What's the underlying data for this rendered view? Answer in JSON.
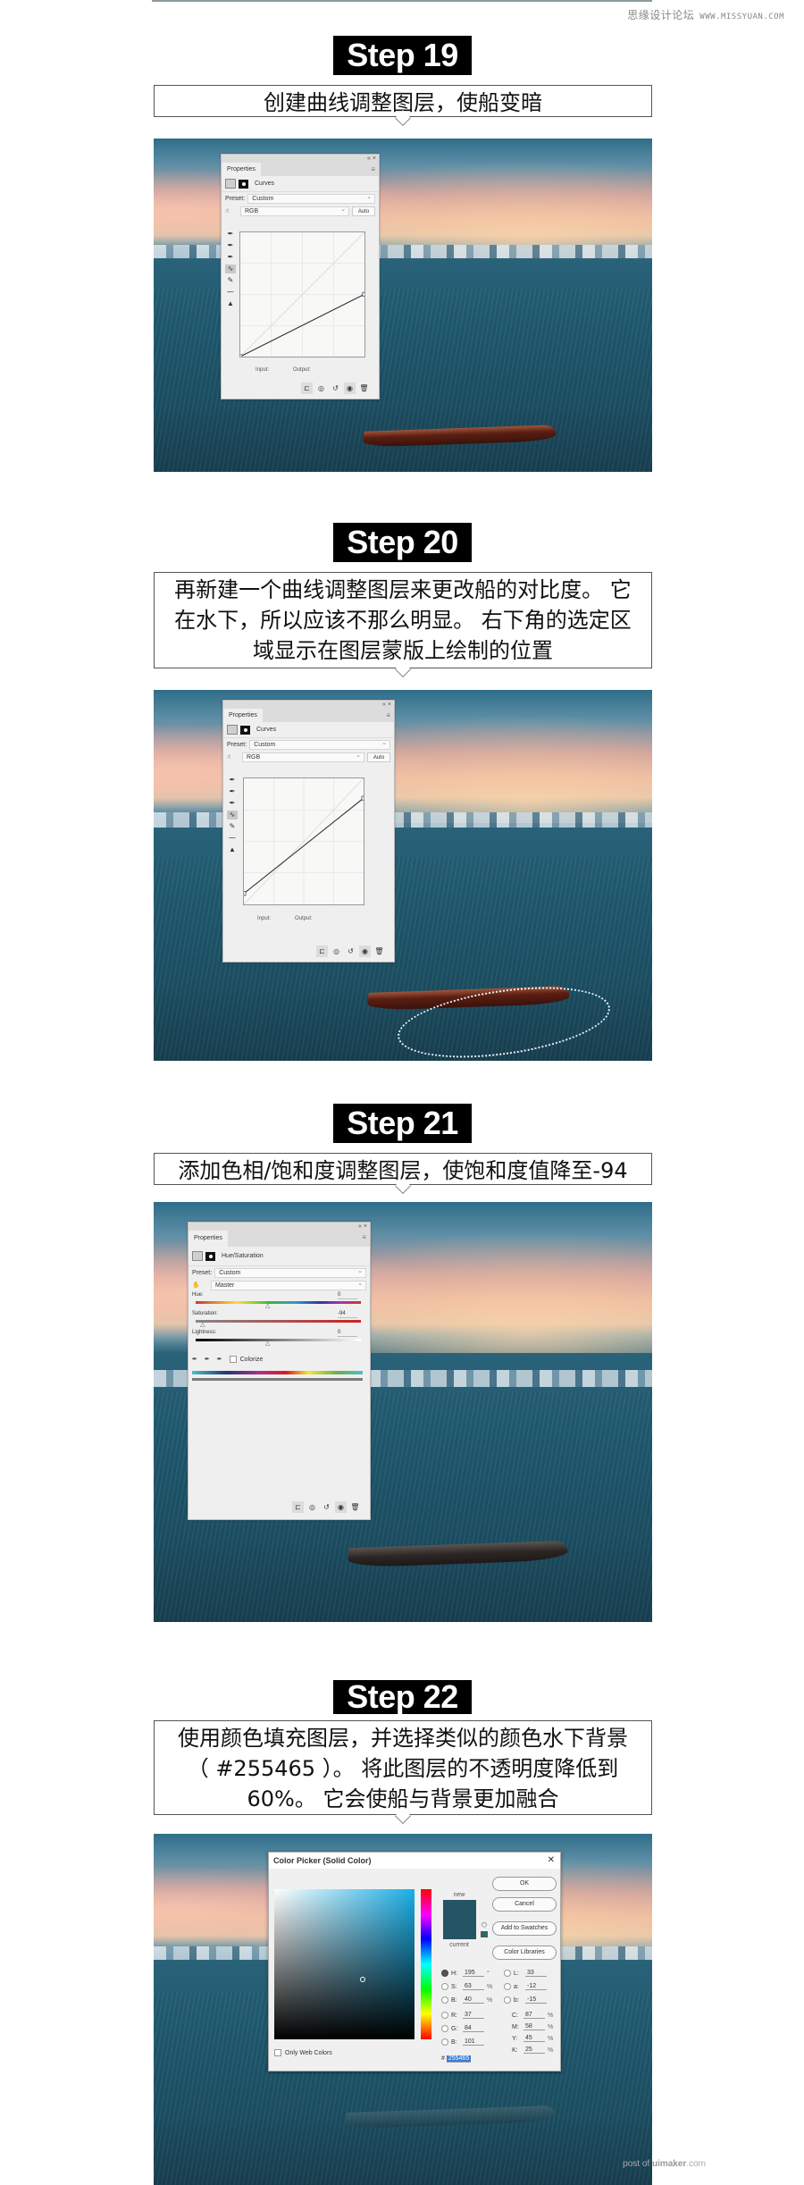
{
  "watermark": {
    "site_name": "思缘设计论坛",
    "site_url": "WWW.MISSYUAN.COM"
  },
  "footer": {
    "prefix": "post of ",
    "brand": "uimaker",
    "suffix": ".com"
  },
  "steps": [
    {
      "title": "Step 19",
      "caption": "创建曲线调整图层，使船变暗",
      "panel": {
        "tab": "Properties",
        "type": "Curves",
        "preset_label": "Preset:",
        "preset_value": "Custom",
        "channel": "RGB",
        "auto_label": "Auto",
        "input_label": "Input:",
        "output_label": "Output:",
        "curve_points": [
          [
            0,
            0
          ],
          [
            255,
            128
          ]
        ]
      }
    },
    {
      "title": "Step 20",
      "caption_lines": [
        "再新建一个曲线调整图层来更改船的对比度。 它",
        "在水下，所以应该不那么明显。 右下角的选定区",
        "域显示在图层蒙版上绘制的位置"
      ],
      "panel": {
        "tab": "Properties",
        "type": "Curves",
        "preset_label": "Preset:",
        "preset_value": "Custom",
        "channel": "RGB",
        "auto_label": "Auto",
        "input_label": "Input:",
        "output_label": "Output:",
        "curve_points": [
          [
            0,
            22
          ],
          [
            255,
            215
          ]
        ]
      }
    },
    {
      "title": "Step 21",
      "caption": "添加色相/饱和度调整图层，使饱和度值降至-94",
      "panel": {
        "tab": "Properties",
        "type": "Hue/Saturation",
        "preset_label": "Preset:",
        "preset_value": "Custom",
        "channel": "Master",
        "hue_label": "Hue:",
        "hue_value": "0",
        "saturation_label": "Saturation:",
        "saturation_value": "-94",
        "lightness_label": "Lightness:",
        "lightness_value": "0",
        "colorize_label": "Colorize",
        "colorize_checked": false
      }
    },
    {
      "title": "Step 22",
      "caption_lines": [
        "使用颜色填充图层，并选择类似的颜色水下背景",
        "（ #255465 ）。 将此图层的不透明度降低到",
        "60%。 它会使船与背景更加融合"
      ],
      "color_picker": {
        "title": "Color Picker (Solid Color)",
        "ok_label": "OK",
        "cancel_label": "Cancel",
        "add_swatches_label": "Add to Swatches",
        "color_libraries_label": "Color Libraries",
        "new_label": "new",
        "current_label": "current",
        "only_web_colors_label": "Only Web Colors",
        "new_color": "#255465",
        "hsb": [
          {
            "key": "H:",
            "value": "195",
            "unit": "°",
            "selected": true
          },
          {
            "key": "S:",
            "value": "63",
            "unit": "%"
          },
          {
            "key": "B:",
            "value": "40",
            "unit": "%"
          }
        ],
        "rgb": [
          {
            "key": "R:",
            "value": "37"
          },
          {
            "key": "G:",
            "value": "84"
          },
          {
            "key": "B:",
            "value": "101"
          }
        ],
        "lab": [
          {
            "key": "L:",
            "value": "33"
          },
          {
            "key": "a:",
            "value": "-12"
          },
          {
            "key": "b:",
            "value": "-15"
          }
        ],
        "cmyk": [
          {
            "key": "C:",
            "value": "87",
            "unit": "%"
          },
          {
            "key": "M:",
            "value": "58",
            "unit": "%"
          },
          {
            "key": "Y:",
            "value": "45",
            "unit": "%"
          },
          {
            "key": "K:",
            "value": "25",
            "unit": "%"
          }
        ],
        "hex_label": "#",
        "hex_value": "255465"
      }
    }
  ]
}
